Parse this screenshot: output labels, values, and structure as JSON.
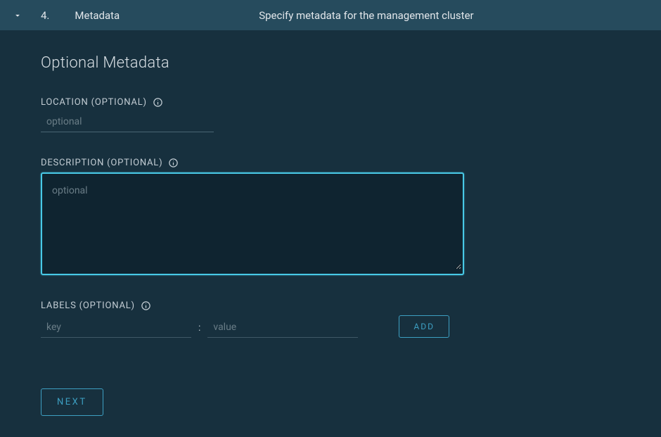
{
  "header": {
    "step_number": "4.",
    "step_name": "Metadata",
    "step_desc": "Specify metadata for the management cluster"
  },
  "section": {
    "title": "Optional Metadata"
  },
  "fields": {
    "location": {
      "label": "LOCATION (OPTIONAL)",
      "placeholder": "optional",
      "value": ""
    },
    "description": {
      "label": "DESCRIPTION (OPTIONAL)",
      "placeholder": "optional",
      "value": ""
    },
    "labels": {
      "label": "LABELS (OPTIONAL)",
      "key_placeholder": "key",
      "value_placeholder": "value",
      "add_button": "ADD"
    }
  },
  "buttons": {
    "next": "NEXT"
  }
}
